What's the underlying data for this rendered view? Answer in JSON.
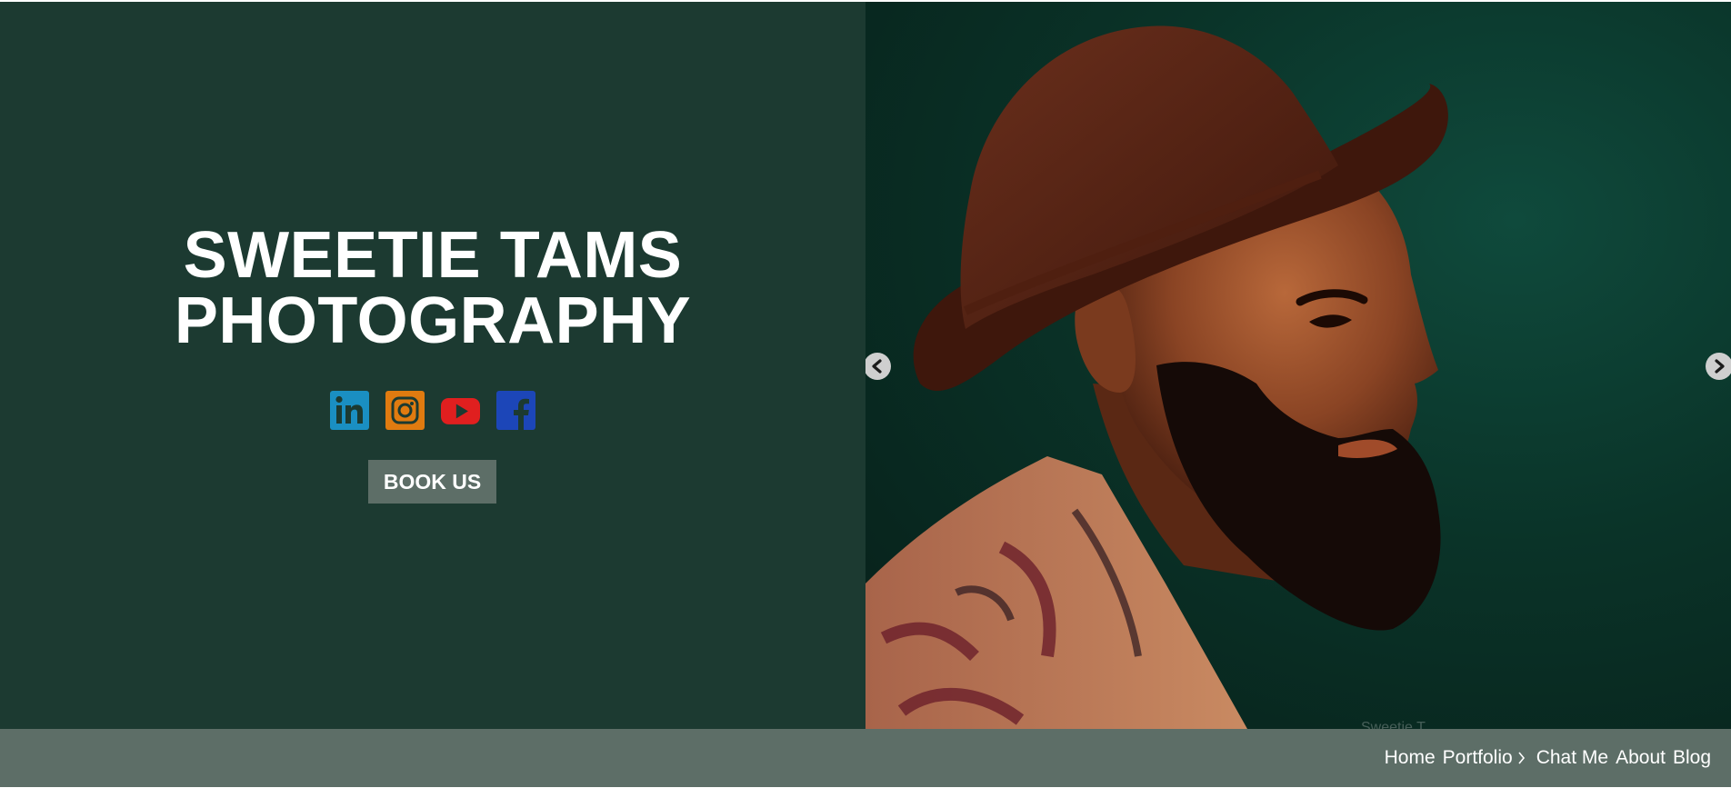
{
  "hero": {
    "title_line1": "SWEETIE TAMS",
    "title_line2": "PHOTOGRAPHY",
    "book_label": "BOOK US",
    "background_color": "#1c3a31",
    "social": [
      {
        "name": "linkedin-icon",
        "color": "#1a8fc2"
      },
      {
        "name": "instagram-icon",
        "color": "#e07b10"
      },
      {
        "name": "youtube-icon",
        "color": "#e01f1f"
      },
      {
        "name": "facebook-icon",
        "color": "#1c46b8"
      }
    ]
  },
  "slideshow": {
    "watermark": "Sweetie T..."
  },
  "nav": {
    "items": [
      {
        "label": "Home"
      },
      {
        "label": "Portfolio"
      },
      {
        "label": "Chat Me"
      },
      {
        "label": "About"
      },
      {
        "label": "Blog"
      }
    ],
    "bar_color": "#5d6e67"
  }
}
